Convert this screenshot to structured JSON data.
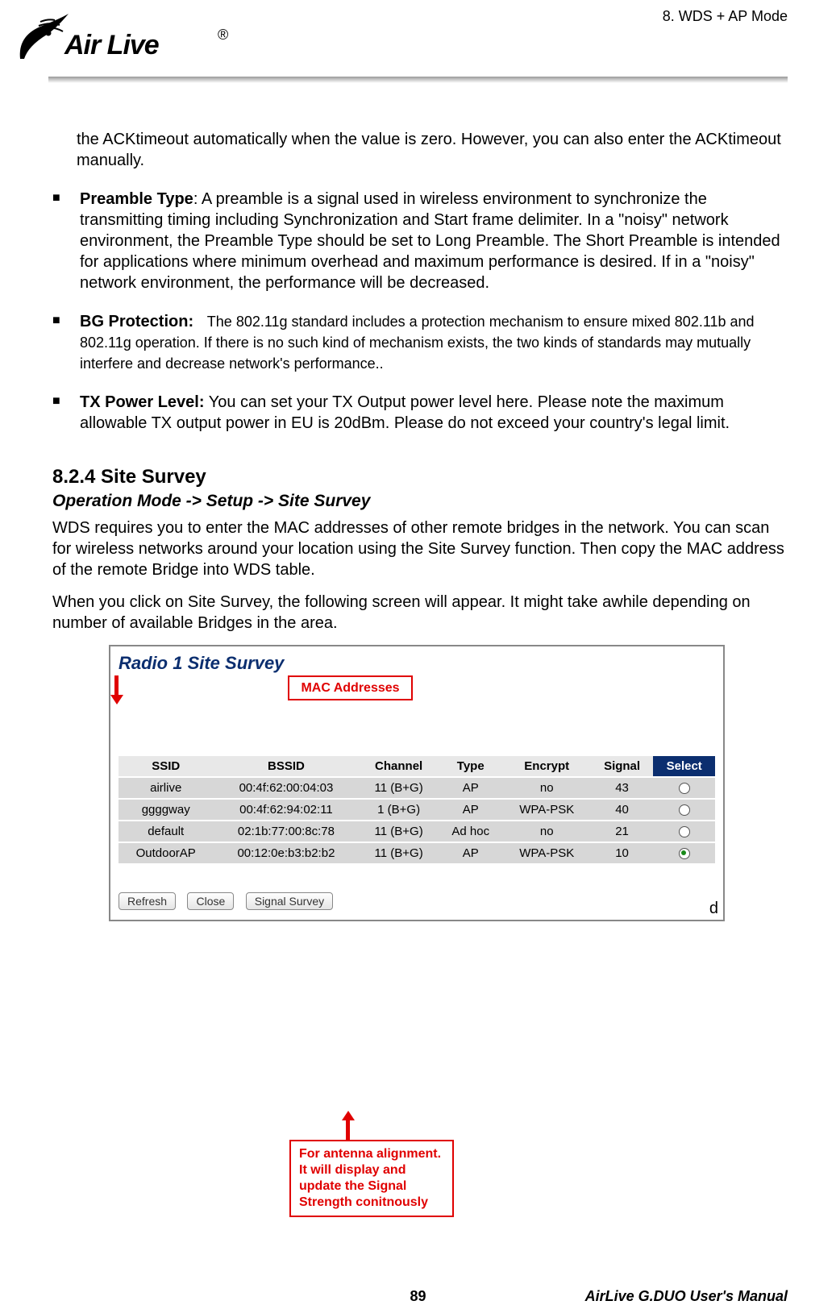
{
  "header": {
    "chapter": "8.  WDS  +  AP  Mode",
    "logo_text": "Air Live",
    "reg": "®"
  },
  "intro_para": "the ACKtimeout automatically when the value is zero.    However, you can also enter the ACKtimeout manually.",
  "bullets": {
    "preamble": {
      "label": "Preamble Type",
      "text": ": A preamble is a signal used in wireless environment to synchronize the transmitting timing including Synchronization and Start frame delimiter. In a \"noisy\" network environment, the Preamble Type should be set to Long Preamble. The Short Preamble is intended for applications where minimum overhead and maximum performance is desired. If in a \"noisy\" network environment, the performance will be decreased."
    },
    "bg": {
      "label": "BG Protection:",
      "text": "The 802.11g standard includes a protection mechanism to ensure mixed 802.11b and 802.11g operation. If there is no such kind of mechanism exists, the two kinds of standards may mutually interfere and decrease network's performance.."
    },
    "tx": {
      "label": "TX Power Level:",
      "text": "    You can set your TX Output power level here.    Please note the maximum allowable TX output power in EU is 20dBm.    Please do not exceed your country's legal limit."
    }
  },
  "section": {
    "title": "8.2.4 Site Survey",
    "breadcrumb": "Operation Mode -> Setup -> Site Survey",
    "p1": "WDS requires you to enter the MAC addresses of other remote bridges in the network.   You can scan for wireless networks around your location using the Site Survey function.   Then copy the MAC address of the remote Bridge into WDS table.",
    "p2": "When you click on Site Survey, the following screen will appear. It might take awhile depending on number of available Bridges in the area."
  },
  "survey": {
    "title": "Radio 1 Site Survey",
    "callout_mac": "MAC Addresses",
    "headers": {
      "ssid": "SSID",
      "bssid": "BSSID",
      "channel": "Channel",
      "type": "Type",
      "encrypt": "Encrypt",
      "signal": "Signal",
      "select": "Select"
    },
    "rows": [
      {
        "ssid": "airlive",
        "bssid": "00:4f:62:00:04:03",
        "channel": "11 (B+G)",
        "type": "AP",
        "encrypt": "no",
        "signal": "43",
        "selected": false
      },
      {
        "ssid": "ggggway",
        "bssid": "00:4f:62:94:02:11",
        "channel": "1 (B+G)",
        "type": "AP",
        "encrypt": "WPA-PSK",
        "signal": "40",
        "selected": false
      },
      {
        "ssid": "default",
        "bssid": "02:1b:77:00:8c:78",
        "channel": "11 (B+G)",
        "type": "Ad hoc",
        "encrypt": "no",
        "signal": "21",
        "selected": false
      },
      {
        "ssid": "OutdoorAP",
        "bssid": "00:12:0e:b3:b2:b2",
        "channel": "11 (B+G)",
        "type": "AP",
        "encrypt": "WPA-PSK",
        "signal": "10",
        "selected": true
      }
    ],
    "buttons": {
      "refresh": "Refresh",
      "close": "Close",
      "signal": "Signal Survey"
    },
    "footer_d": "d",
    "callout_antenna": "For antenna alignment.    It will display and update the Signal Strength conitnously"
  },
  "footer": {
    "page": "89",
    "right": "AirLive  G.DUO  User's  Manual"
  }
}
